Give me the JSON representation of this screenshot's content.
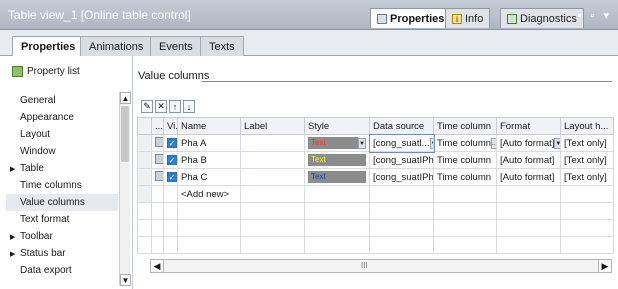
{
  "window": {
    "title": "Table view_1 [Online table control]",
    "tabs": [
      {
        "label": "Properties",
        "icon": "properties-icon"
      },
      {
        "label": "Info",
        "icon": "info-icon"
      },
      {
        "label": "Diagnostics",
        "icon": "diagnostics-icon"
      }
    ],
    "controls": "▪ ▫ ▾"
  },
  "subtabs": [
    "Properties",
    "Animations",
    "Events",
    "Texts"
  ],
  "sidebar": {
    "header": "Property list",
    "items": [
      {
        "label": "General",
        "arrow": ""
      },
      {
        "label": "Appearance",
        "arrow": ""
      },
      {
        "label": "Layout",
        "arrow": ""
      },
      {
        "label": "Window",
        "arrow": ""
      },
      {
        "label": "Table",
        "arrow": "▶"
      },
      {
        "label": "Time columns",
        "arrow": ""
      },
      {
        "label": "Value columns",
        "arrow": ""
      },
      {
        "label": "Text format",
        "arrow": ""
      },
      {
        "label": "Toolbar",
        "arrow": "▶"
      },
      {
        "label": "Status bar",
        "arrow": "▶"
      },
      {
        "label": "Data export",
        "arrow": ""
      }
    ],
    "selected": "Value columns"
  },
  "main": {
    "section_title": "Value columns",
    "columns": [
      "...",
      "Vi...",
      "Name",
      "Label",
      "Style",
      "Data source",
      "Time column",
      "Format",
      "Layout h..."
    ],
    "rows": [
      {
        "name": "Pha A",
        "label": "",
        "style": "Text",
        "style_color": "#ff3030",
        "data_source": "[cong_suatl...",
        "time_column": "Time column",
        "format": "[Auto format]",
        "layout": "[Text only]"
      },
      {
        "name": "Pha B",
        "label": "",
        "style": "Text",
        "style_color": "#ffff30",
        "data_source": "[cong_suatIPha...",
        "time_column": "Time column",
        "format": "[Auto format]",
        "layout": "[Text only]"
      },
      {
        "name": "Pha C",
        "label": "",
        "style": "Text",
        "style_color": "#1f3fa0",
        "data_source": "[cong_suatIPha...",
        "time_column": "Time column",
        "format": "[Auto format]",
        "layout": "[Text only]"
      }
    ],
    "add_new": "<Add new>",
    "ellipsis": "...",
    "hscroll_mid": "III"
  }
}
